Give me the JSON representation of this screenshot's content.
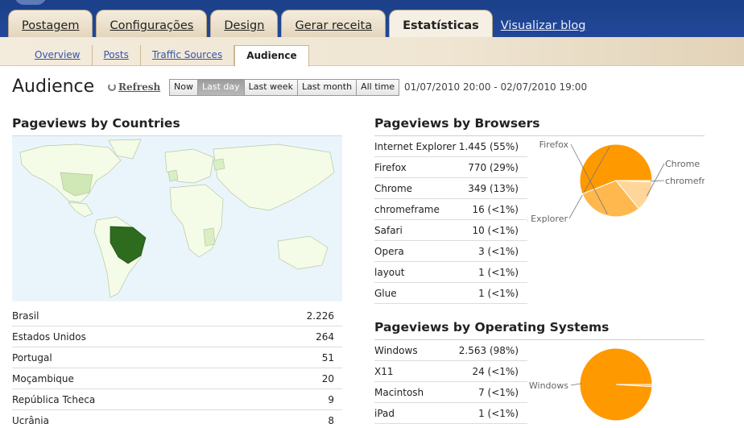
{
  "nav": {
    "tabs": [
      {
        "label": "Postagem"
      },
      {
        "label": "Configurações"
      },
      {
        "label": "Design"
      },
      {
        "label": "Gerar receita"
      },
      {
        "label": "Estatísticas"
      }
    ],
    "view_blog": "Visualizar blog",
    "subtabs": [
      {
        "label": "Overview"
      },
      {
        "label": "Posts"
      },
      {
        "label": "Traffic Sources"
      },
      {
        "label": "Audience"
      }
    ]
  },
  "header": {
    "title": "Audience",
    "refresh": "Refresh",
    "ranges": [
      "Now",
      "Last day",
      "Last week",
      "Last month",
      "All time"
    ],
    "active_range": "Last day",
    "date_range": "01/07/2010 20:00 - 02/07/2010 19:00"
  },
  "countries": {
    "title": "Pageviews by Countries",
    "rows": [
      {
        "name": "Brasil",
        "value": "2.226"
      },
      {
        "name": "Estados Unidos",
        "value": "264"
      },
      {
        "name": "Portugal",
        "value": "51"
      },
      {
        "name": "Moçambique",
        "value": "20"
      },
      {
        "name": "República Tcheca",
        "value": "9"
      },
      {
        "name": "Ucrânia",
        "value": "8"
      }
    ]
  },
  "browsers": {
    "title": "Pageviews by Browsers",
    "rows": [
      {
        "name": "Internet Explorer",
        "value": "1.445 (55%)"
      },
      {
        "name": "Firefox",
        "value": "770 (29%)"
      },
      {
        "name": "Chrome",
        "value": "349 (13%)"
      },
      {
        "name": "chromeframe",
        "value": "16 (<1%)"
      },
      {
        "name": "Safari",
        "value": "10 (<1%)"
      },
      {
        "name": "Opera",
        "value": "3 (<1%)"
      },
      {
        "name": "layout",
        "value": "1 (<1%)"
      },
      {
        "name": "Glue",
        "value": "1 (<1%)"
      }
    ],
    "pie": [
      {
        "label": "Internet Explorer",
        "shown": "et Explorer",
        "value": 1445,
        "color": "#ff9900"
      },
      {
        "label": "Firefox",
        "shown": "Firefox",
        "value": 770,
        "color": "#ffb84d"
      },
      {
        "label": "Chrome",
        "shown": "Chrome",
        "value": 349,
        "color": "#ffd699"
      },
      {
        "label": "chromeframe",
        "shown": "chromefra",
        "value": 16,
        "color": "#ffe9c4"
      }
    ]
  },
  "os": {
    "title": "Pageviews by Operating Systems",
    "rows": [
      {
        "name": "Windows",
        "value": "2.563 (98%)"
      },
      {
        "name": "X11",
        "value": "24 (<1%)"
      },
      {
        "name": "Macintosh",
        "value": "7 (<1%)"
      },
      {
        "name": "iPad",
        "value": "1 (<1%)"
      }
    ],
    "pie": [
      {
        "label": "Windows",
        "shown": "Windows",
        "value": 2563,
        "color": "#ff9900"
      },
      {
        "label": "X11",
        "shown": "",
        "value": 24,
        "color": "#ffb84d"
      }
    ]
  }
}
